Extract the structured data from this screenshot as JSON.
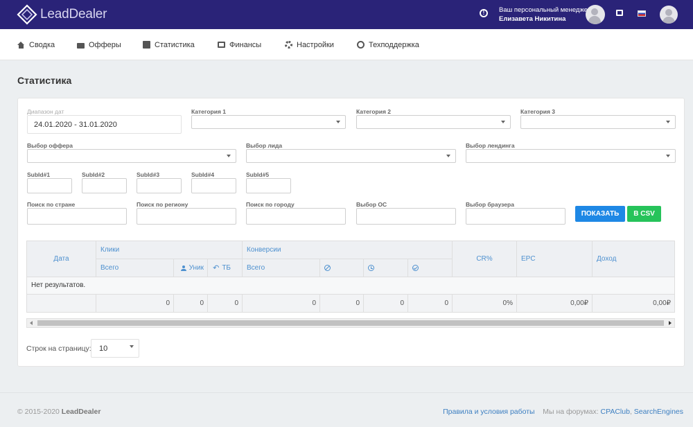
{
  "brand": {
    "name": "LeadDealer"
  },
  "topbar": {
    "manager_label": "Ваш персональный менеджер",
    "manager_name": "Елизавета Никитина",
    "info_icon": "info-icon",
    "wallet_icon": "wallet-icon",
    "language": "ru-flag"
  },
  "nav": {
    "items": [
      {
        "label": "Сводка",
        "icon": "home-icon"
      },
      {
        "label": "Офферы",
        "icon": "folder-icon"
      },
      {
        "label": "Статистика",
        "icon": "chart-icon"
      },
      {
        "label": "Финансы",
        "icon": "wallet-icon"
      },
      {
        "label": "Настройки",
        "icon": "gear-icon"
      },
      {
        "label": "Техподдержка",
        "icon": "lifebuoy-icon"
      }
    ]
  },
  "page": {
    "title": "Статистика"
  },
  "filters": {
    "date_range_label": "Диапазон дат",
    "date_range_value": "24.01.2020 - 31.01.2020",
    "category1_label": "Категория 1",
    "category2_label": "Категория 2",
    "category3_label": "Категория 3",
    "offer_label": "Выбор оффера",
    "lead_label": "Выбор лида",
    "landing_label": "Выбор лендинга",
    "subids": [
      "SubId#1",
      "SubId#2",
      "SubId#3",
      "SubId#4",
      "SubId#5"
    ],
    "country_label": "Поиск по стране",
    "region_label": "Поиск по региону",
    "city_label": "Поиск по городу",
    "os_label": "Выбор ОС",
    "browser_label": "Выбор браузера",
    "show_button": "ПОКАЗАТЬ",
    "csv_button": "В CSV"
  },
  "table": {
    "col_date": "Дата",
    "group_clicks": "Клики",
    "group_conversions": "Конверсии",
    "clicks_total": "Всего",
    "clicks_unique": "Уник",
    "clicks_tb": "ТБ",
    "conv_total": "Всего",
    "col_cr": "CR%",
    "col_epc": "EPC",
    "col_income": "Доход",
    "empty_text": "Нет результатов.",
    "totals": [
      "0",
      "0",
      "0",
      "0",
      "0",
      "0",
      "0",
      "0%",
      "0,00₽",
      "0,00₽"
    ]
  },
  "pagination": {
    "rows_label": "Строк на страницу:",
    "rows_value": "10"
  },
  "footer": {
    "copyright": "© 2015-2020",
    "brand": "LeadDealer",
    "terms_link": "Правила и условия работы",
    "forums_label": "Мы на форумах:",
    "forum1": "CPAClub",
    "separator": ",",
    "forum2": "SearchEngines"
  },
  "colors": {
    "topbar": "#2a2378",
    "accent_blue": "#1e88e5",
    "accent_green": "#26c35a",
    "header_text": "#4d90cf"
  }
}
